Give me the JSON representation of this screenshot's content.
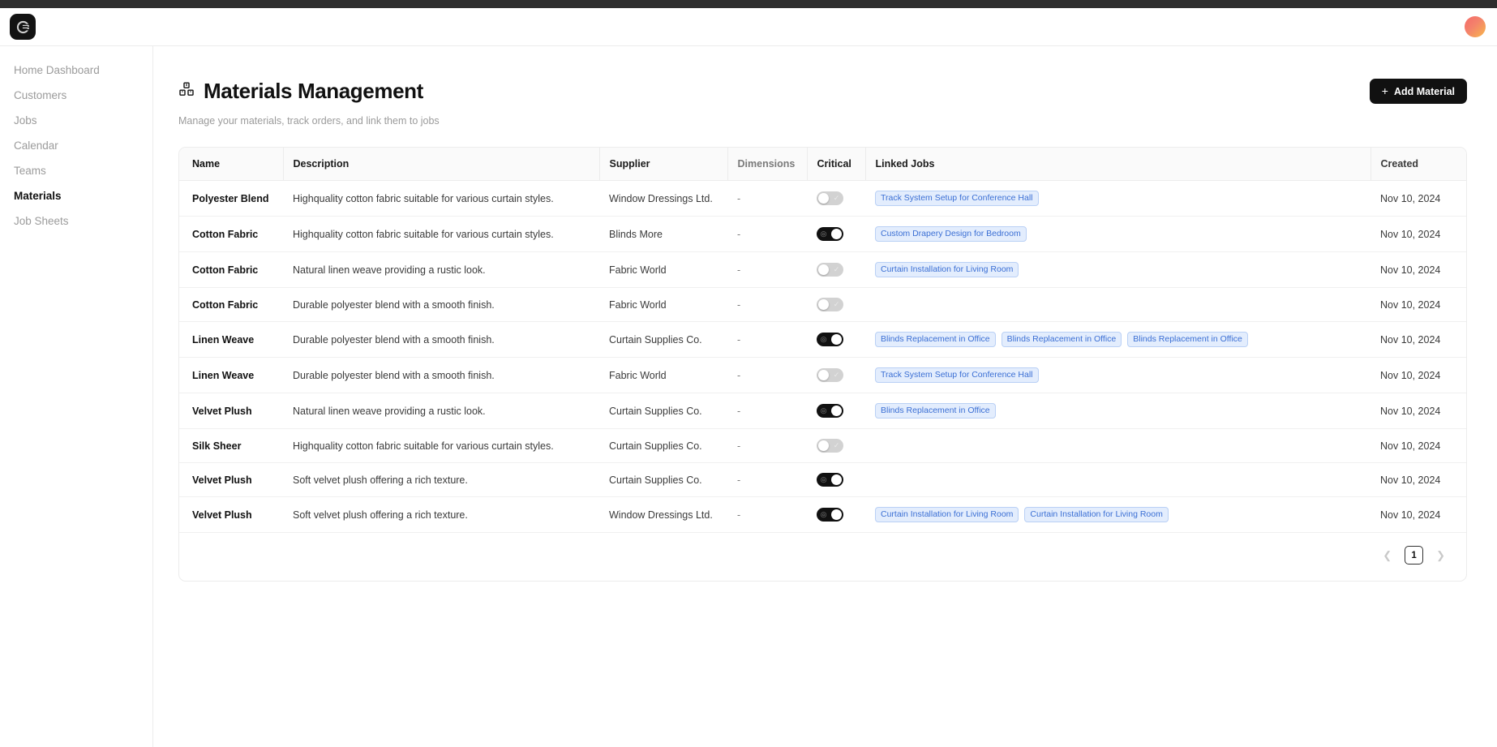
{
  "topbar": {
    "logo_icon": "brand-logo-icon",
    "avatar_icon": "user-avatar"
  },
  "sidebar": {
    "items": [
      {
        "label": "Home Dashboard",
        "active": false
      },
      {
        "label": "Customers",
        "active": false
      },
      {
        "label": "Jobs",
        "active": false
      },
      {
        "label": "Calendar",
        "active": false
      },
      {
        "label": "Teams",
        "active": false
      },
      {
        "label": "Materials",
        "active": true
      },
      {
        "label": "Job Sheets",
        "active": false
      }
    ]
  },
  "page": {
    "icon": "boxes-icon",
    "title": "Materials Management",
    "subtitle": "Manage your materials, track orders, and link them to jobs",
    "add_button": {
      "icon": "plus-icon",
      "label": "Add Material"
    }
  },
  "table": {
    "columns": [
      "Name",
      "Description",
      "Supplier",
      "Dimensions",
      "Critical",
      "Linked Jobs",
      "Created"
    ],
    "rows": [
      {
        "name": "Polyester Blend",
        "description": "Highquality cotton fabric suitable for various curtain styles.",
        "supplier": "Window Dressings Ltd.",
        "dimensions": "-",
        "critical": false,
        "linked_jobs": [
          "Track System Setup for Conference Hall"
        ],
        "created": "Nov 10, 2024"
      },
      {
        "name": "Cotton Fabric",
        "description": "Highquality cotton fabric suitable for various curtain styles.",
        "supplier": "Blinds More",
        "dimensions": "-",
        "critical": true,
        "linked_jobs": [
          "Custom Drapery Design for Bedroom"
        ],
        "created": "Nov 10, 2024"
      },
      {
        "name": "Cotton Fabric",
        "description": "Natural linen weave providing a rustic look.",
        "supplier": "Fabric World",
        "dimensions": "-",
        "critical": false,
        "linked_jobs": [
          "Curtain Installation for Living Room"
        ],
        "created": "Nov 10, 2024"
      },
      {
        "name": "Cotton Fabric",
        "description": "Durable polyester blend with a smooth finish.",
        "supplier": "Fabric World",
        "dimensions": "-",
        "critical": false,
        "linked_jobs": [],
        "created": "Nov 10, 2024"
      },
      {
        "name": "Linen Weave",
        "description": "Durable polyester blend with a smooth finish.",
        "supplier": "Curtain Supplies Co.",
        "dimensions": "-",
        "critical": true,
        "linked_jobs": [
          "Blinds Replacement in Office",
          "Blinds Replacement in Office",
          "Blinds Replacement in Office"
        ],
        "created": "Nov 10, 2024"
      },
      {
        "name": "Linen Weave",
        "description": "Durable polyester blend with a smooth finish.",
        "supplier": "Fabric World",
        "dimensions": "-",
        "critical": false,
        "linked_jobs": [
          "Track System Setup for Conference Hall"
        ],
        "created": "Nov 10, 2024"
      },
      {
        "name": "Velvet Plush",
        "description": "Natural linen weave providing a rustic look.",
        "supplier": "Curtain Supplies Co.",
        "dimensions": "-",
        "critical": true,
        "linked_jobs": [
          "Blinds Replacement in Office"
        ],
        "created": "Nov 10, 2024"
      },
      {
        "name": "Silk Sheer",
        "description": "Highquality cotton fabric suitable for various curtain styles.",
        "supplier": "Curtain Supplies Co.",
        "dimensions": "-",
        "critical": false,
        "linked_jobs": [],
        "created": "Nov 10, 2024"
      },
      {
        "name": "Velvet Plush",
        "description": "Soft velvet plush offering a rich texture.",
        "supplier": "Curtain Supplies Co.",
        "dimensions": "-",
        "critical": true,
        "linked_jobs": [],
        "created": "Nov 10, 2024"
      },
      {
        "name": "Velvet Plush",
        "description": "Soft velvet plush offering a rich texture.",
        "supplier": "Window Dressings Ltd.",
        "dimensions": "-",
        "critical": true,
        "linked_jobs": [
          "Curtain Installation for Living Room",
          "Curtain Installation for Living Room"
        ],
        "created": "Nov 10, 2024"
      }
    ]
  },
  "pagination": {
    "prev_icon": "chevron-left-icon",
    "next_icon": "chevron-right-icon",
    "current_page": "1"
  },
  "colors": {
    "accent": "#111111",
    "badge_bg": "#e3edfd",
    "badge_text": "#3b6fd4",
    "badge_border": "#b9d0f5"
  }
}
